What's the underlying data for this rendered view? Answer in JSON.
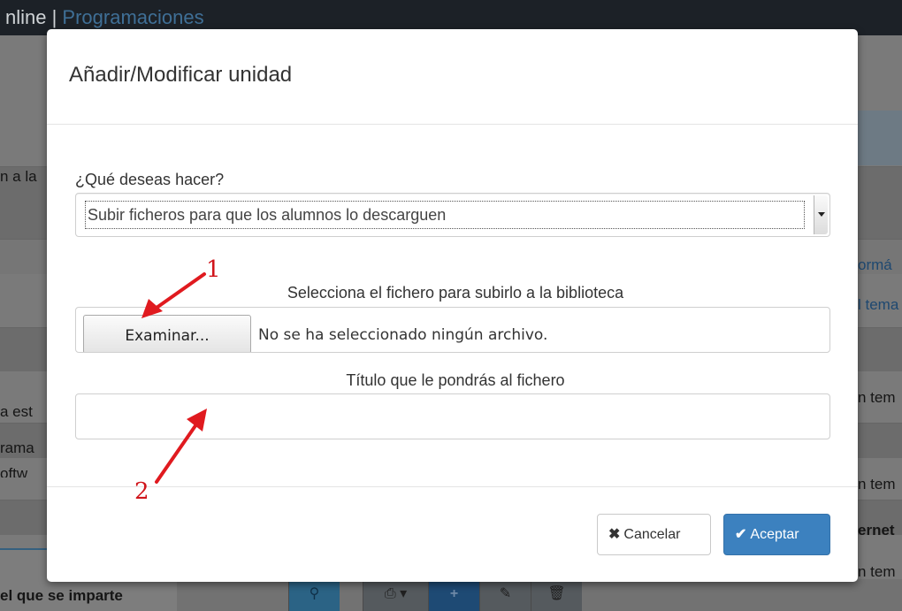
{
  "background": {
    "topbar": {
      "prefix": "nline | ",
      "link": "Programaciones"
    },
    "left_texts": [
      "n a la",
      "a est",
      "rama",
      "oftw"
    ],
    "right_texts": [
      "ormá",
      "l tema",
      "n tem",
      "n tem",
      "ernet",
      "n tem"
    ],
    "bottom_left_label": "el que se imparte",
    "toolbar_icons": [
      "search-icon",
      "print-icon",
      "add-icon",
      "edit-icon",
      "delete-icon"
    ]
  },
  "modal": {
    "title": "Añadir/Modificar unidad",
    "action_label": "¿Qué deseas hacer?",
    "action_select": {
      "selected": "Subir ficheros para que los alumnos lo descarguen"
    },
    "file_label": "Selecciona el fichero para subirlo a la biblioteca",
    "file_button": "Examinar...",
    "file_status": "No se ha seleccionado ningún archivo.",
    "title_label": "Título que le pondrás al fichero",
    "title_value": "",
    "cancel_label": "Cancelar",
    "accept_label": "Aceptar"
  },
  "annotations": {
    "first": "1",
    "second": "2",
    "color": "#d0151b"
  },
  "colors": {
    "accent": "#3c81bf",
    "topbar": "#1c2127"
  }
}
